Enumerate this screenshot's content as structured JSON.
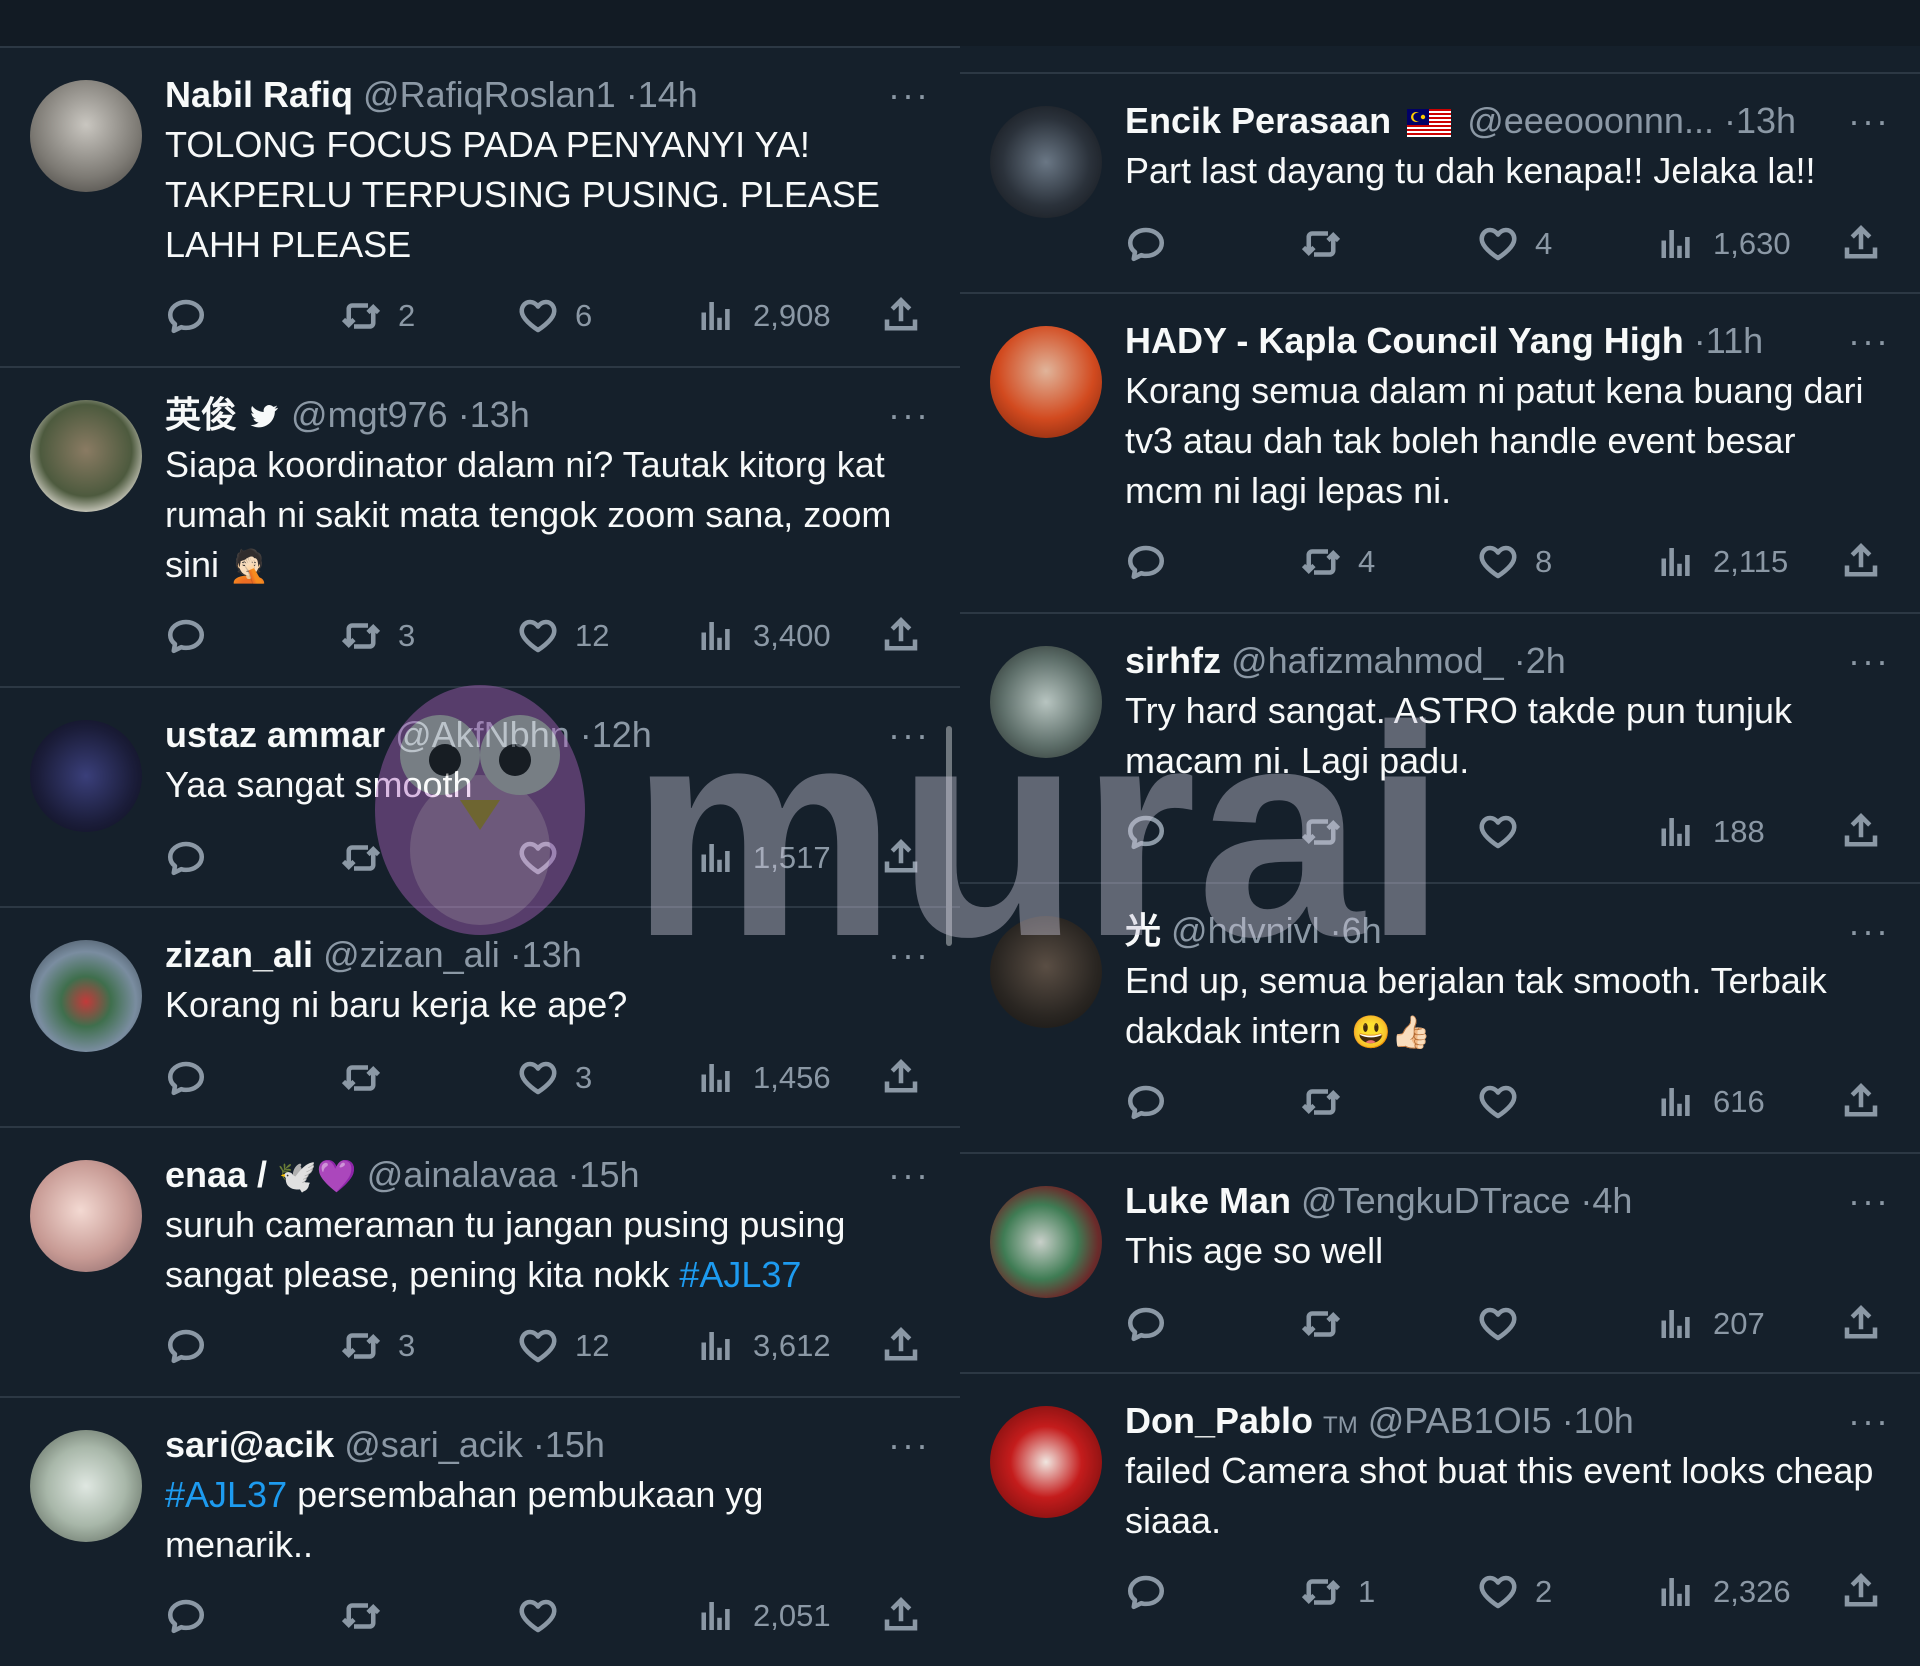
{
  "colors": {
    "background": "#15202b",
    "text": "#f7f9f9",
    "muted": "#8b98a5",
    "link": "#1d9bf0",
    "divider": "#2c3844",
    "watermark": "#9a6bbf"
  },
  "watermark_text": "murai",
  "left_column": [
    {
      "name": "Nabil Rafiq",
      "handle": "@RafiqRoslan1",
      "time": "14h",
      "text": "TOLONG FOCUS PADA PENYANYI YA! TAKPERLU TERPUSING PUSING. PLEASE LAHH PLEASE",
      "retweets": "2",
      "likes": "6",
      "views": "2,908",
      "more": "···"
    },
    {
      "name": "英俊",
      "name_badge": "🐦",
      "handle": "@mgt976",
      "time": "13h",
      "text": "Siapa koordinator dalam ni? Tautak kitorg kat rumah ni sakit mata tengok zoom sana, zoom sini",
      "text_emoji": "🤦🏻",
      "retweets": "3",
      "likes": "12",
      "views": "3,400",
      "more": "···"
    },
    {
      "name": "ustaz ammar",
      "handle": "@AkfNbhn",
      "time": "12h",
      "text": "Yaa sangat smooth",
      "retweets": "",
      "likes": "",
      "views": "1,517",
      "more": "···"
    },
    {
      "name": "zizan_ali",
      "handle": "@zizan_ali",
      "time": "13h",
      "text": "Korang ni baru kerja ke ape?",
      "retweets": "",
      "likes": "3",
      "views": "1,456",
      "more": "···"
    },
    {
      "name": "enaa /",
      "name_emoji": "🕊️💜",
      "handle": "@ainalavaa",
      "time": "15h",
      "text_before": "suruh cameraman tu jangan pusing pusing sangat please, pening kita nokk ",
      "hashtag": "#AJL37",
      "retweets": "3",
      "likes": "12",
      "views": "3,612",
      "more": "···"
    },
    {
      "name": "sari@acik",
      "handle": "@sari_acik",
      "time": "15h",
      "hashtag": "#AJL37",
      "text_after": " persembahan pembukaan yg menarik..",
      "retweets": "",
      "likes": "",
      "views": "2,051",
      "more": "···"
    }
  ],
  "right_column": [
    {
      "name": "Encik Perasaan",
      "handle": "@eeeooonnn...",
      "time": "13h",
      "text": "Part last dayang tu dah kenapa!! Jelaka la!!",
      "retweets": "",
      "likes": "4",
      "views": "1,630",
      "more": "···"
    },
    {
      "name": "HADY - Kapla Council Yang High",
      "handle": "",
      "time": "11h",
      "text": "Korang semua dalam ni patut kena buang dari tv3 atau dah tak boleh handle event besar mcm ni lagi lepas ni.",
      "retweets": "4",
      "likes": "8",
      "views": "2,115",
      "more": "···"
    },
    {
      "name": "sirhfz",
      "handle": "@hafizmahmod_",
      "time": "2h",
      "text": "Try hard sangat. ASTRO takde pun tunjuk macam ni. Lagi padu.",
      "retweets": "",
      "likes": "",
      "views": "188",
      "more": "···"
    },
    {
      "name": "光",
      "handle": "@hdvnivl",
      "time": "6h",
      "text": "End up, semua berjalan tak smooth. Terbaik dakdak intern",
      "text_emoji": "😃👍🏻",
      "retweets": "",
      "likes": "",
      "views": "616",
      "more": "···"
    },
    {
      "name": "Luke Man",
      "handle": "@TengkuDTrace",
      "time": "4h",
      "text": "This age so well",
      "retweets": "",
      "likes": "",
      "views": "207",
      "more": "···"
    },
    {
      "name": "Don_Pablo",
      "name_badge": "TM",
      "handle": "@PAB1OI5",
      "time": "10h",
      "text": "failed Camera shot buat this event looks cheap siaaa.",
      "retweets": "1",
      "likes": "2",
      "views": "2,326",
      "more": "···"
    }
  ]
}
